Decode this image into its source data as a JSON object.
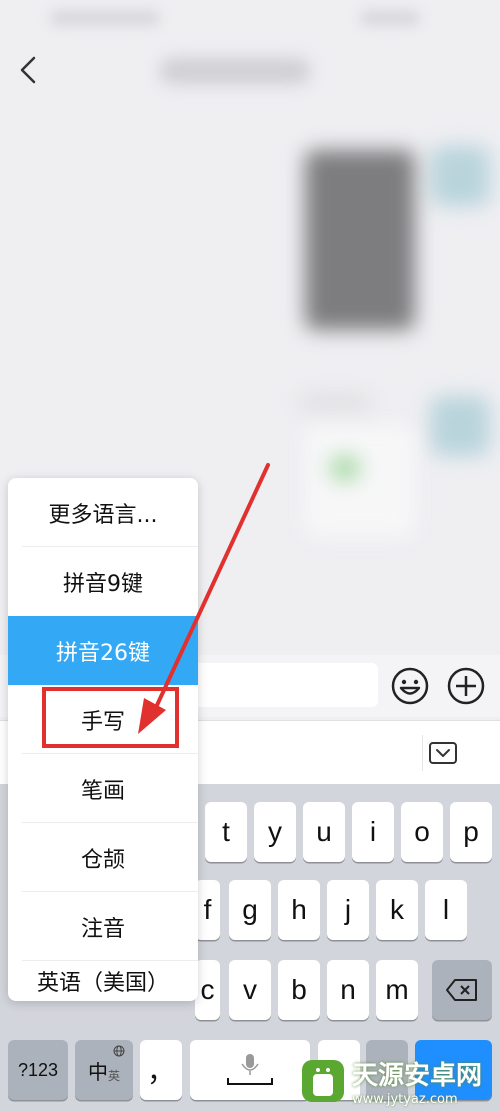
{
  "language_menu": {
    "items": [
      {
        "label": "更多语言..."
      },
      {
        "label": "拼音9键"
      },
      {
        "label": "拼音26键",
        "selected": true
      },
      {
        "label": "手写"
      },
      {
        "label": "笔画"
      },
      {
        "label": "仓颉"
      },
      {
        "label": "注音"
      },
      {
        "label": "英语（美国）"
      }
    ],
    "selected_color": "#33a8f5"
  },
  "keyboard": {
    "row1": [
      "t",
      "y",
      "u",
      "i",
      "o",
      "p"
    ],
    "row2": [
      "f",
      "g",
      "h",
      "j",
      "k",
      "l"
    ],
    "row3": [
      "c",
      "v",
      "b",
      "n",
      "m"
    ],
    "bottom": {
      "num_label": "?123",
      "zh_label": "中",
      "en_label": "英",
      "comma_label": "，"
    }
  },
  "icons": {
    "back": "chevron-left-icon",
    "emoji": "emoji-icon",
    "plus": "plus-circle-icon",
    "collapse": "keyboard-collapse-icon",
    "backspace": "backspace-icon",
    "globe": "globe-icon",
    "mic": "microphone-icon"
  },
  "annotation": {
    "highlight_color": "#e0312f"
  },
  "watermark": {
    "title": "天源安卓网",
    "url": "www.jytyaz.com"
  }
}
